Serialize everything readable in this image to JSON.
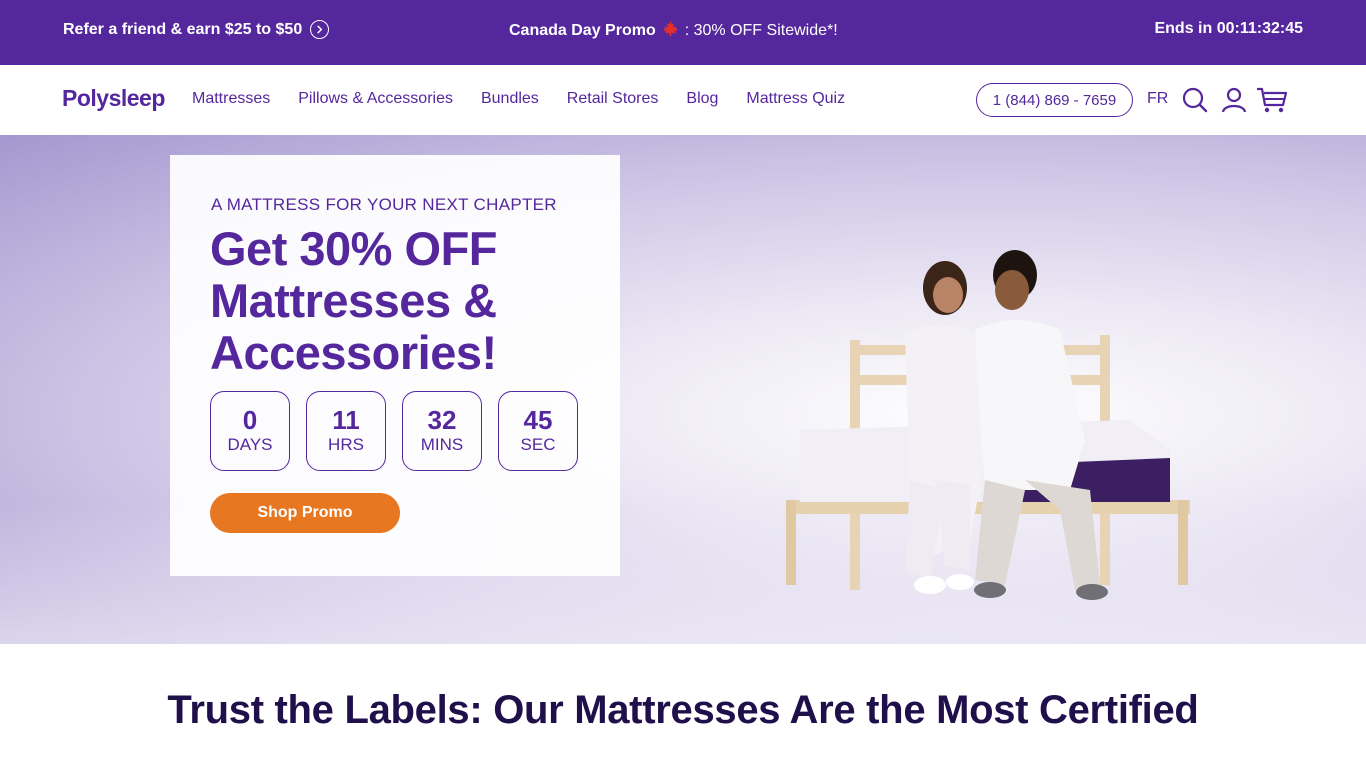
{
  "promo_bar": {
    "refer_text": "Refer a friend & earn $25 to $50",
    "promo_title": "Canada Day Promo",
    "promo_detail": ": 30% OFF Sitewide*!",
    "ends_in": "Ends in 00:11:32:45"
  },
  "nav": {
    "logo": "Polysleep",
    "links": [
      "Mattresses",
      "Pillows & Accessories",
      "Bundles",
      "Retail Stores",
      "Blog",
      "Mattress Quiz"
    ],
    "phone": "1 (844) 869 - 7659",
    "language": "FR"
  },
  "hero": {
    "eyebrow": "A MATTRESS FOR YOUR NEXT CHAPTER",
    "headline": "Get 30% OFF Mattresses & Accessories!",
    "countdown": [
      {
        "value": "0",
        "unit": "DAYS"
      },
      {
        "value": "11",
        "unit": "HRS"
      },
      {
        "value": "32",
        "unit": "MINS"
      },
      {
        "value": "45",
        "unit": "SEC"
      }
    ],
    "cta_label": "Shop Promo"
  },
  "trust": {
    "heading": "Trust the Labels: Our Mattresses Are the Most Certified"
  },
  "colors": {
    "brand_purple": "#55279d",
    "cta_orange": "#e87722",
    "dark_heading": "#1f0f4a"
  },
  "icons": [
    "arrow-right-circle-icon",
    "maple-leaf-icon",
    "search-icon",
    "user-icon",
    "cart-icon"
  ]
}
